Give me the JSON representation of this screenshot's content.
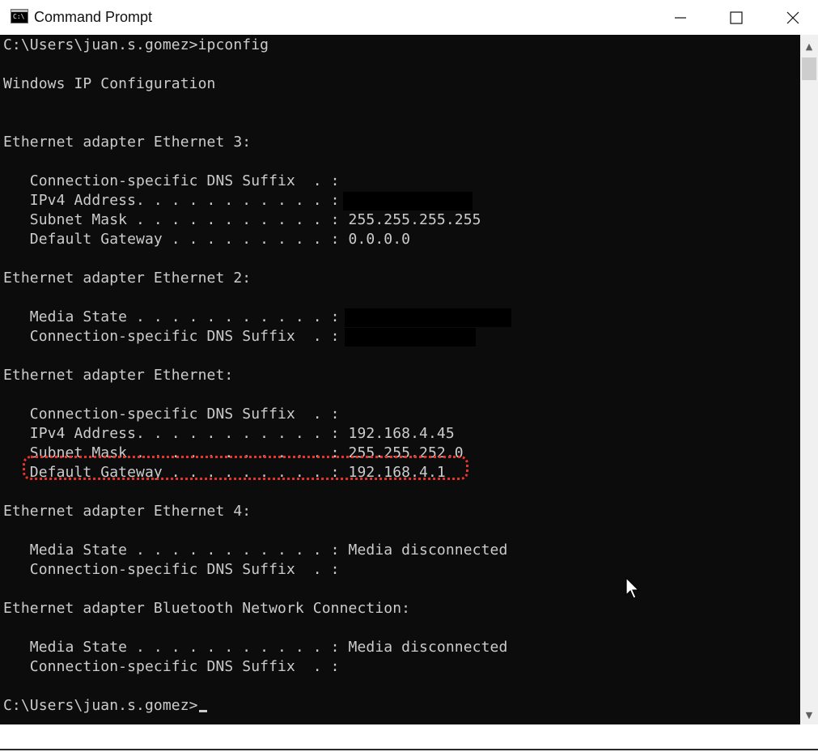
{
  "window": {
    "title": "Command Prompt",
    "icon": "cmd-icon",
    "icon_glyph": "C:\\",
    "controls": [
      "minimize-icon",
      "maximize-icon",
      "close-icon"
    ]
  },
  "console": {
    "prompt_command": "C:\\Users\\juan.s.gomez>ipconfig",
    "header": "Windows IP Configuration",
    "adapters": [
      {
        "title": "Ethernet adapter Ethernet 3:",
        "rows": [
          {
            "label": "   Connection-specific DNS Suffix  . : ",
            "value": ""
          },
          {
            "label": "   IPv4 Address. . . . . . . . . . . : ",
            "value": "",
            "redacted": true
          },
          {
            "label": "   Subnet Mask . . . . . . . . . . . : ",
            "value": "255.255.255.255"
          },
          {
            "label": "   Default Gateway . . . . . . . . . : ",
            "value": "0.0.0.0"
          }
        ]
      },
      {
        "title": "Ethernet adapter Ethernet 2:",
        "rows": [
          {
            "label": "   Media State . . . . . . . . . . . : ",
            "value": "",
            "redacted": true
          },
          {
            "label": "   Connection-specific DNS Suffix  . : ",
            "value": "",
            "redacted": true
          }
        ]
      },
      {
        "title": "Ethernet adapter Ethernet:",
        "rows": [
          {
            "label": "   Connection-specific DNS Suffix  . : ",
            "value": ""
          },
          {
            "label": "   IPv4 Address. . . . . . . . . . . : ",
            "value": "192.168.4.45",
            "highlighted": true
          },
          {
            "label": "   Subnet Mask . . . . . . . . . . . : ",
            "value": "255.255.252.0"
          },
          {
            "label": "   Default Gateway . . . . . . . . . : ",
            "value": "192.168.4.1"
          }
        ]
      },
      {
        "title": "Ethernet adapter Ethernet 4:",
        "rows": [
          {
            "label": "   Media State . . . . . . . . . . . : ",
            "value": "Media disconnected"
          },
          {
            "label": "   Connection-specific DNS Suffix  . : ",
            "value": ""
          }
        ]
      },
      {
        "title": "Ethernet adapter Bluetooth Network Connection:",
        "rows": [
          {
            "label": "   Media State . . . . . . . . . . . : ",
            "value": "Media disconnected"
          },
          {
            "label": "   Connection-specific DNS Suffix  . : ",
            "value": ""
          }
        ]
      }
    ],
    "final_prompt": "C:\\Users\\juan.s.gomez>"
  },
  "colors": {
    "console_bg": "#0c0c0c",
    "console_text": "#cccccc",
    "highlight_annotation": "#e8342a",
    "redaction": "#000000"
  }
}
